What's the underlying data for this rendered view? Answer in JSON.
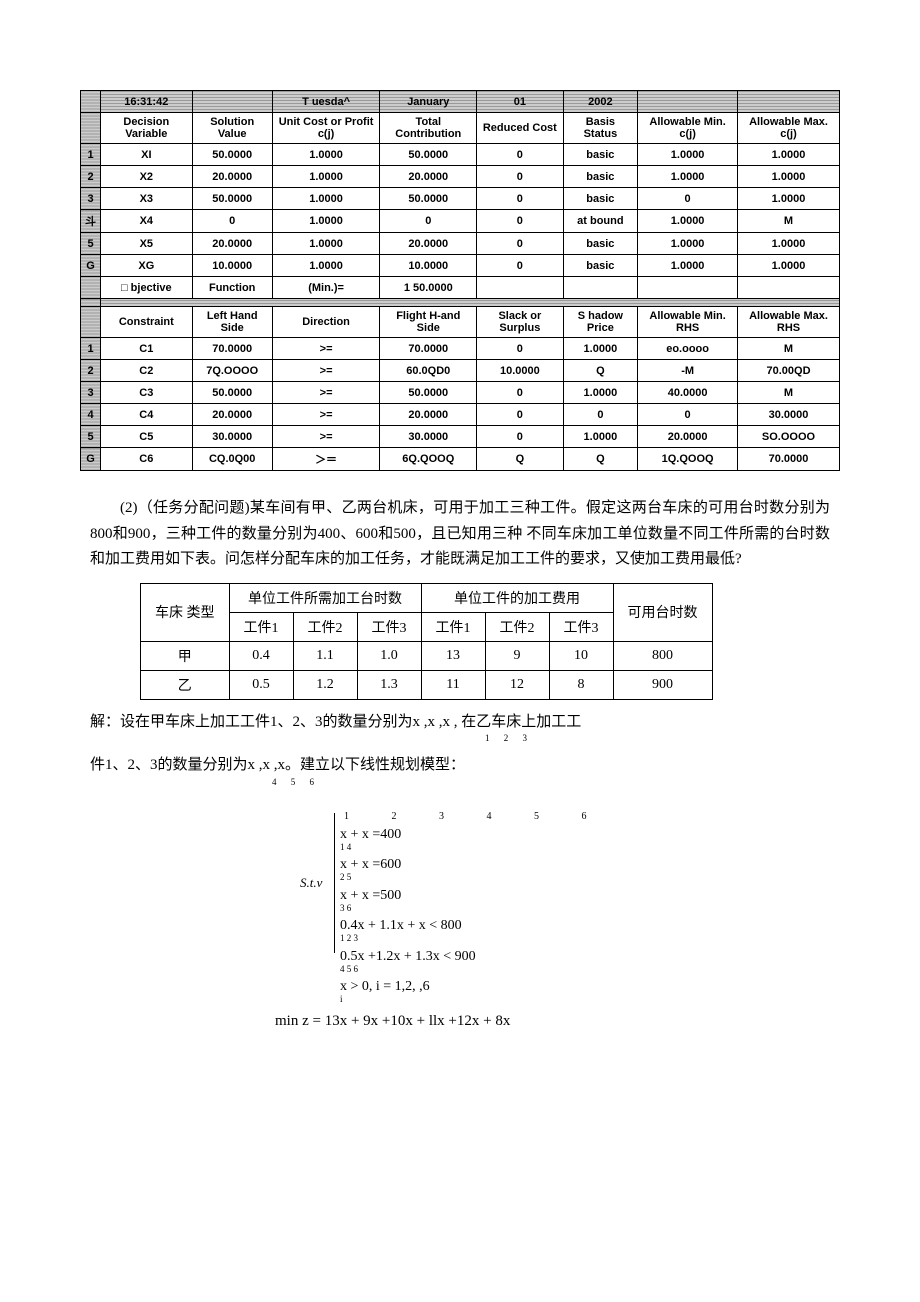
{
  "lp_table": {
    "header_row": [
      "16:31:42",
      "",
      "T uesda^",
      "January",
      "01",
      "2002",
      "",
      ""
    ],
    "columns": [
      "Decision Variable",
      "Solution Value",
      "Unit Cost or Profit c(j)",
      "Total Contribution",
      "Reduced Cost",
      "Basis Status",
      "Allowable Min. c(j)",
      "Allowable Max. c(j)"
    ],
    "vars": [
      {
        "n": "1",
        "dv": "XI",
        "sv": "50.0000",
        "uc": "1.0000",
        "tc": "50.0000",
        "rc": "0",
        "bs": "basic",
        "amin": "1.0000",
        "amax": "1.0000"
      },
      {
        "n": "2",
        "dv": "X2",
        "sv": "20.0000",
        "uc": "1.0000",
        "tc": "20.0000",
        "rc": "0",
        "bs": "basic",
        "amin": "1.0000",
        "amax": "1.0000"
      },
      {
        "n": "3",
        "dv": "X3",
        "sv": "50.0000",
        "uc": "1.0000",
        "tc": "50.0000",
        "rc": "0",
        "bs": "basic",
        "amin": "0",
        "amax": "1.0000"
      },
      {
        "n": "斗",
        "dv": "X4",
        "sv": "0",
        "uc": "1.0000",
        "tc": "0",
        "rc": "0",
        "bs": "at bound",
        "amin": "1.0000",
        "amax": "M"
      },
      {
        "n": "5",
        "dv": "X5",
        "sv": "20.0000",
        "uc": "1.0000",
        "tc": "20.0000",
        "rc": "0",
        "bs": "basic",
        "amin": "1.0000",
        "amax": "1.0000"
      },
      {
        "n": "G",
        "dv": "XG",
        "sv": "10.0000",
        "uc": "1.0000",
        "tc": "10.0000",
        "rc": "0",
        "bs": "basic",
        "amin": "1.0000",
        "amax": "1.0000"
      }
    ],
    "objective": {
      "lbl": "□ bjective",
      "fn": "Function",
      "eq": "(Min.)=",
      "val": "1 50.0000"
    },
    "cons_columns": [
      "Constraint",
      "Left Hand Side",
      "Direction",
      "Flight H-and Side",
      "Slack or Surplus",
      "S hadow Price",
      "Allowable Min. RHS",
      "Allowable Max. RHS"
    ],
    "cons": [
      {
        "n": "1",
        "c": "C1",
        "lhs": "70.0000",
        "dir": ">=",
        "rhs": "70.0000",
        "sl": "0",
        "sp": "1.0000",
        "amin": "eo.oooo",
        "amax": "M"
      },
      {
        "n": "2",
        "c": "C2",
        "lhs": "7Q.OOOO",
        "dir": ">=",
        "rhs": "60.0QD0",
        "sl": "10.0000",
        "sp": "Q",
        "amin": "-M",
        "amax": "70.00QD"
      },
      {
        "n": "3",
        "c": "C3",
        "lhs": "50.0000",
        "dir": ">=",
        "rhs": "50.0000",
        "sl": "0",
        "sp": "1.0000",
        "amin": "40.0000",
        "amax": "M"
      },
      {
        "n": "4",
        "c": "C4",
        "lhs": "20.0000",
        "dir": ">=",
        "rhs": "20.0000",
        "sl": "0",
        "sp": "0",
        "amin": "0",
        "amax": "30.0000"
      },
      {
        "n": "5",
        "c": "C5",
        "lhs": "30.0000",
        "dir": ">=",
        "rhs": "30.0000",
        "sl": "0",
        "sp": "1.0000",
        "amin": "20.0000",
        "amax": "SO.OOOO"
      },
      {
        "n": "G",
        "c": "C6",
        "lhs": "CQ.0Q00",
        "dir": "＞＝",
        "rhs": "6Q.QOOQ",
        "sl": "Q",
        "sp": "Q",
        "amin": "1Q.QOOQ",
        "amax": "70.0000"
      }
    ]
  },
  "problem_text": "(2)（任务分配问题)某车间有甲、乙两台机床，可用于加工三种工件。假定这两台车床的可用台时数分别为800和900，三种工件的数量分别为400、600和500，且已知用三种 不同车床加工单位数量不同工件所需的台时数和加工费用如下表。问怎样分配车床的加工任务，才能既满足加工工件的要求，又使加工费用最低?",
  "ptable": {
    "h1": "车床 类型",
    "h2": "单位工件所需加工台时数",
    "h3": "单位工件的加工费用",
    "h4": "可用台时数",
    "sub": [
      "工件1",
      "工件2",
      "工件3",
      "工件1",
      "工件2",
      "工件3"
    ],
    "rows": [
      {
        "lbl": "甲",
        "v": [
          "0.4",
          "1.1",
          "1.0",
          "13",
          "9",
          "10",
          "800"
        ]
      },
      {
        "lbl": "乙",
        "v": [
          "0.5",
          "1.2",
          "1.3",
          "11",
          "12",
          "8",
          "900"
        ]
      }
    ]
  },
  "sol1": "解：设在甲车床上加工工件1、2、3的数量分别为x ,x ,x , 在乙车床上加工工",
  "sol1_subs": "1   2   3",
  "sol2": "件1、2、3的数量分别为x ,x ,x。建立以下线性规划模型：",
  "sol2_subs": "4   5   6",
  "math": {
    "topsubs": "1    2     3      4     5      6",
    "l1": "x  + x  =400",
    "s1": " 1      4",
    "l2": "x  + x  =600",
    "s2": " 2      5",
    "l3": "x  + x  =500",
    "s3": " 3      6",
    "l4": "0.4x + 1.1x + x < 800",
    "s4": "     1       2    3",
    "l5": "0.5x +1.2x + 1.3x < 900",
    "s5": "     4      5        6",
    "l6": "x > 0, i = 1,2,   ,6",
    "s6": " i",
    "stv": "S.t.v"
  },
  "minz": "min z =  13x + 9x +10x + llx +12x + 8x"
}
